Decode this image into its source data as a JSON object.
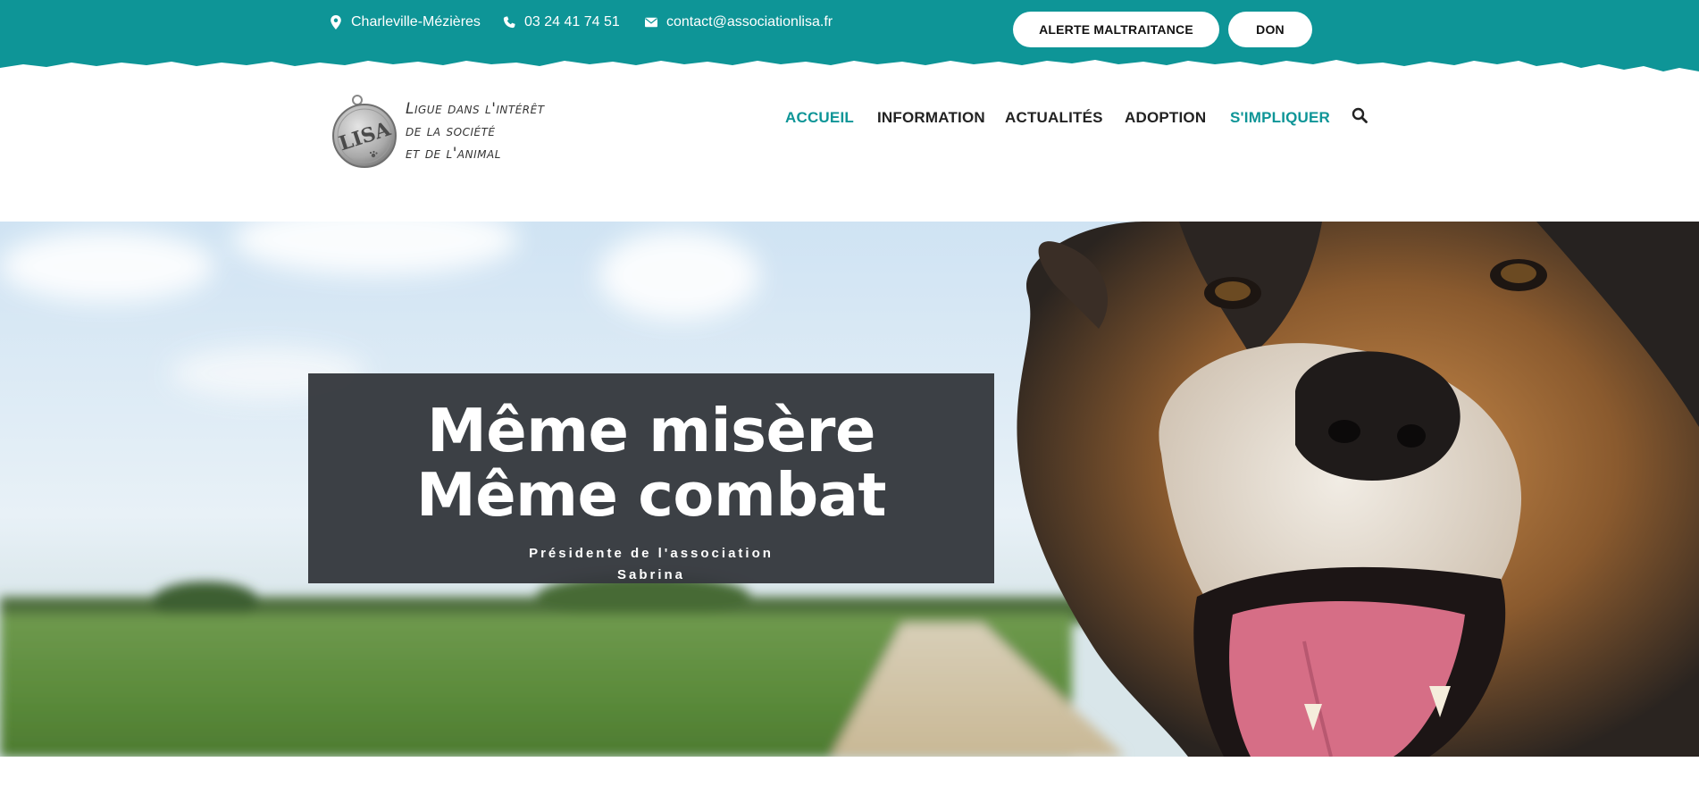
{
  "colors": {
    "brand": "#0e9597",
    "nav_text": "#222222",
    "caption_bg": "#35383d"
  },
  "topbar": {
    "location": {
      "icon": "map-pin-icon",
      "text": "Charleville-Mézières"
    },
    "phone": {
      "icon": "phone-icon",
      "text": "03 24 41 74 51"
    },
    "email": {
      "icon": "envelope-icon",
      "text": "contact@associationlisa.fr"
    },
    "buttons": {
      "alert": "ALERTE MALTRAITANCE",
      "donate": "DON"
    }
  },
  "header": {
    "logo": {
      "badge_text": "LISA",
      "lines": [
        "Ligue dans l'intérêt",
        "de la société",
        "et de l'animal"
      ]
    },
    "nav": [
      {
        "label": "ACCUEIL",
        "active": true
      },
      {
        "label": "INFORMATION",
        "active": false
      },
      {
        "label": "ACTUALITÉS",
        "active": false
      },
      {
        "label": "ADOPTION",
        "active": false
      },
      {
        "label": "S'IMPLIQUER",
        "active": true
      }
    ],
    "search_icon": "search-icon"
  },
  "hero": {
    "title_line1": "Même misère",
    "title_line2": "Même combat",
    "subtitle_line1": "Présidente de l'association",
    "subtitle_line2": "Sabrina"
  }
}
